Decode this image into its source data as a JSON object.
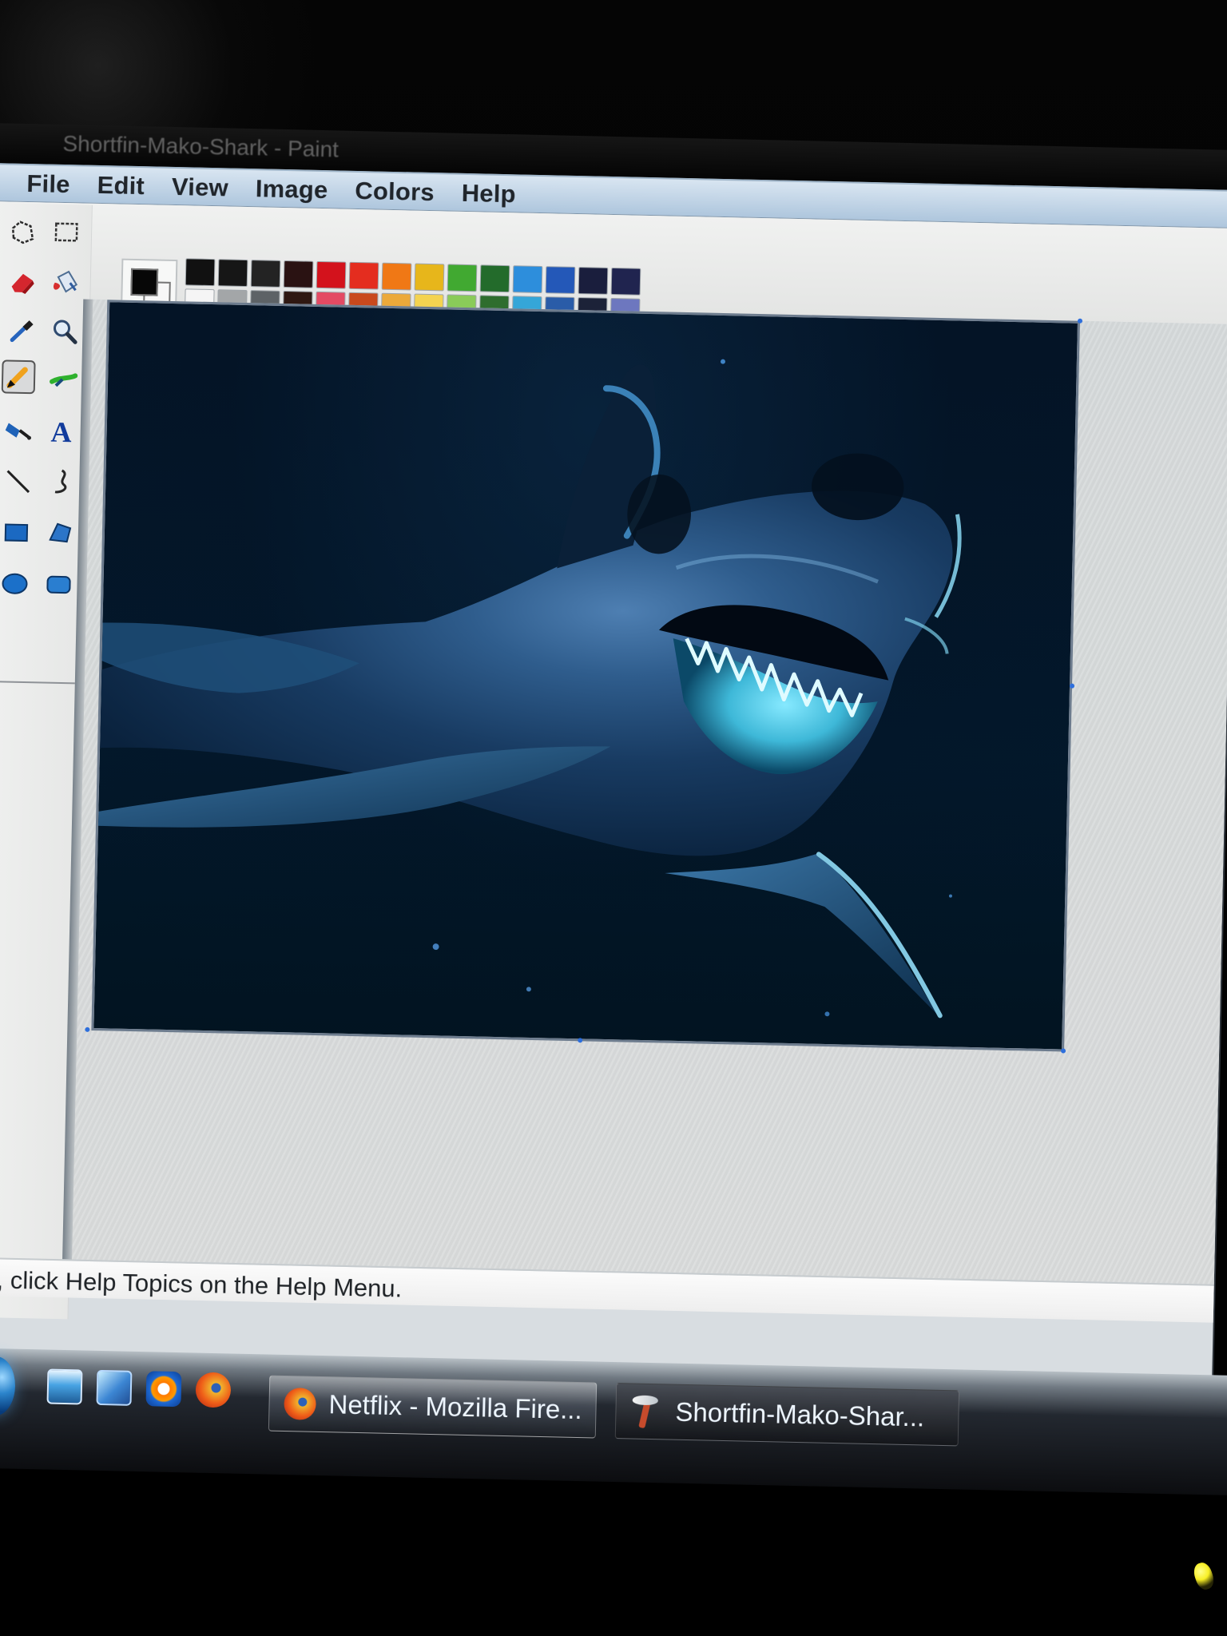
{
  "window": {
    "title": "Shortfin-Mako-Shark - Paint"
  },
  "menu": {
    "items": [
      "File",
      "Edit",
      "View",
      "Image",
      "Colors",
      "Help"
    ]
  },
  "tools": [
    {
      "name": "free-form-select",
      "icon": "free-form-select-icon"
    },
    {
      "name": "rectangle-select",
      "icon": "select-icon"
    },
    {
      "name": "eraser",
      "icon": "eraser-icon"
    },
    {
      "name": "fill-with-color",
      "icon": "fill-icon"
    },
    {
      "name": "pick-color",
      "icon": "eyedropper-icon"
    },
    {
      "name": "magnifier",
      "icon": "magnifier-icon"
    },
    {
      "name": "pencil",
      "icon": "pencil-icon",
      "selected": true
    },
    {
      "name": "brush",
      "icon": "brush-icon"
    },
    {
      "name": "airbrush",
      "icon": "airbrush-icon"
    },
    {
      "name": "text",
      "icon": "text-icon",
      "glyph": "A"
    },
    {
      "name": "line",
      "icon": "line-icon"
    },
    {
      "name": "curve",
      "icon": "curve-icon"
    },
    {
      "name": "rectangle",
      "icon": "rectangle-icon"
    },
    {
      "name": "polygon",
      "icon": "polygon-icon"
    },
    {
      "name": "ellipse",
      "icon": "ellipse-icon"
    },
    {
      "name": "rounded-rectangle",
      "icon": "rounded-rectangle-icon"
    }
  ],
  "colors": {
    "primary": "#070707",
    "secondary": "#f7f7f7",
    "palette_top": [
      "#111111",
      "#161616",
      "#232323",
      "#2a1212",
      "#d3121c",
      "#e42d1f",
      "#f07815",
      "#e7b61b",
      "#41a931",
      "#236b2b",
      "#2d8edc",
      "#2458b8",
      "#1a1e3d",
      "#20244f"
    ],
    "palette_bottom": [
      "#f5f5f5",
      "#a3a6a8",
      "#5d6266",
      "#2f1812",
      "#e44a63",
      "#c9491d",
      "#eca93a",
      "#f4d350",
      "#8acb59",
      "#2e6d2e",
      "#35a6d8",
      "#2a5ca8",
      "#1c2238",
      "#6d77bf"
    ]
  },
  "status": {
    "text": "lp, click Help Topics on the Help Menu."
  },
  "taskbar": {
    "buttons": [
      {
        "label": "Netflix - Mozilla Fire...",
        "icon": "firefox-icon"
      },
      {
        "label": "Shortfin-Mako-Shar...",
        "icon": "paint-icon"
      }
    ]
  }
}
